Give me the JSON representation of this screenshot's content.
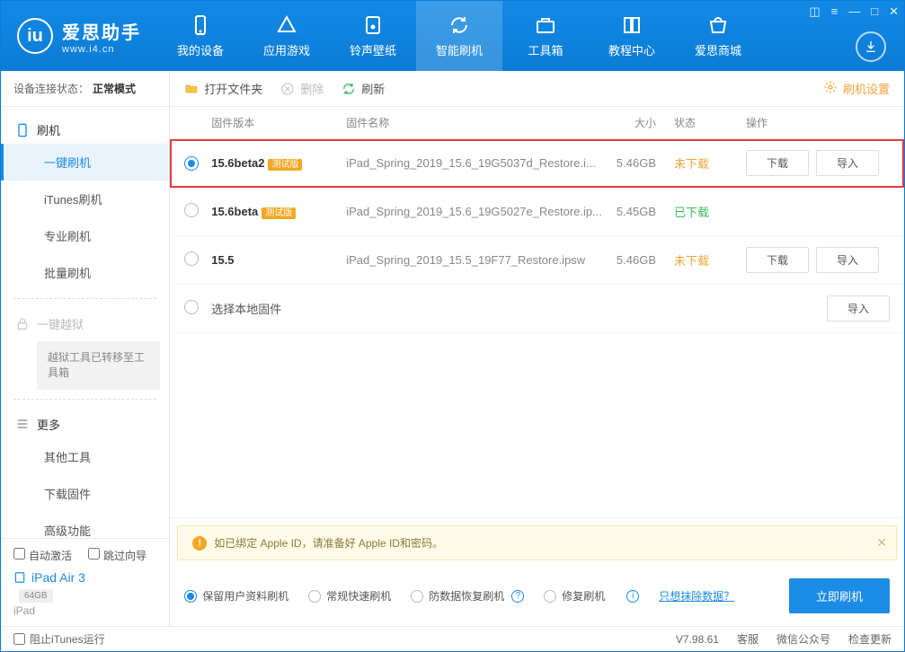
{
  "app": {
    "name": "爱思助手",
    "domain": "www.i4.cn"
  },
  "nav": {
    "items": [
      {
        "label": "我的设备"
      },
      {
        "label": "应用游戏"
      },
      {
        "label": "铃声壁纸"
      },
      {
        "label": "智能刷机"
      },
      {
        "label": "工具箱"
      },
      {
        "label": "教程中心"
      },
      {
        "label": "爱思商城"
      }
    ]
  },
  "status": {
    "label": "设备连接状态：",
    "mode": "正常模式"
  },
  "sidebar": {
    "flash_group": "刷机",
    "items": {
      "one_key": "一键刷机",
      "itunes": "iTunes刷机",
      "pro": "专业刷机",
      "batch": "批量刷机"
    },
    "jailbreak_group": "一键越狱",
    "jailbreak_note": "越狱工具已转移至工具箱",
    "more_group": "更多",
    "more": {
      "other_tools": "其他工具",
      "dl_fw": "下载固件",
      "advanced": "高级功能"
    }
  },
  "device_panel": {
    "auto_activate": "自动激活",
    "skip_guide": "跳过向导",
    "name": "iPad Air 3",
    "storage": "64GB",
    "type": "iPad"
  },
  "toolbar": {
    "open_folder": "打开文件夹",
    "delete": "删除",
    "refresh": "刷新",
    "settings": "刷机设置"
  },
  "table": {
    "headers": {
      "version": "固件版本",
      "name": "固件名称",
      "size": "大小",
      "status": "状态",
      "ops": "操作"
    },
    "rows": [
      {
        "version": "15.6beta2",
        "beta": "测试版",
        "name": "iPad_Spring_2019_15.6_19G5037d_Restore.i...",
        "size": "5.46GB",
        "status": "未下载",
        "status_cls": "nd",
        "selected": true,
        "highlight": true,
        "ops": [
          "下载",
          "导入"
        ]
      },
      {
        "version": "15.6beta",
        "beta": "测试版",
        "name": "iPad_Spring_2019_15.6_19G5027e_Restore.ip...",
        "size": "5.45GB",
        "status": "已下载",
        "status_cls": "dl",
        "selected": false,
        "highlight": false,
        "ops": []
      },
      {
        "version": "15.5",
        "beta": "",
        "name": "iPad_Spring_2019_15.5_19F77_Restore.ipsw",
        "size": "5.46GB",
        "status": "未下载",
        "status_cls": "nd",
        "selected": false,
        "highlight": false,
        "ops": [
          "下载",
          "导入"
        ]
      }
    ],
    "local_row": {
      "label": "选择本地固件",
      "op": "导入"
    }
  },
  "warn": {
    "text": "如已绑定 Apple ID，请准备好 Apple ID和密码。"
  },
  "options": {
    "keep_data": "保留用户资料刷机",
    "fast": "常规快速刷机",
    "anti_loss": "防数据恢复刷机",
    "repair": "修复刷机",
    "erase_link": "只想抹除数据？",
    "flash_btn": "立即刷机"
  },
  "footer": {
    "block_itunes": "阻止iTunes运行",
    "version": "V7.98.61",
    "support": "客服",
    "wechat": "微信公众号",
    "update": "检查更新"
  }
}
